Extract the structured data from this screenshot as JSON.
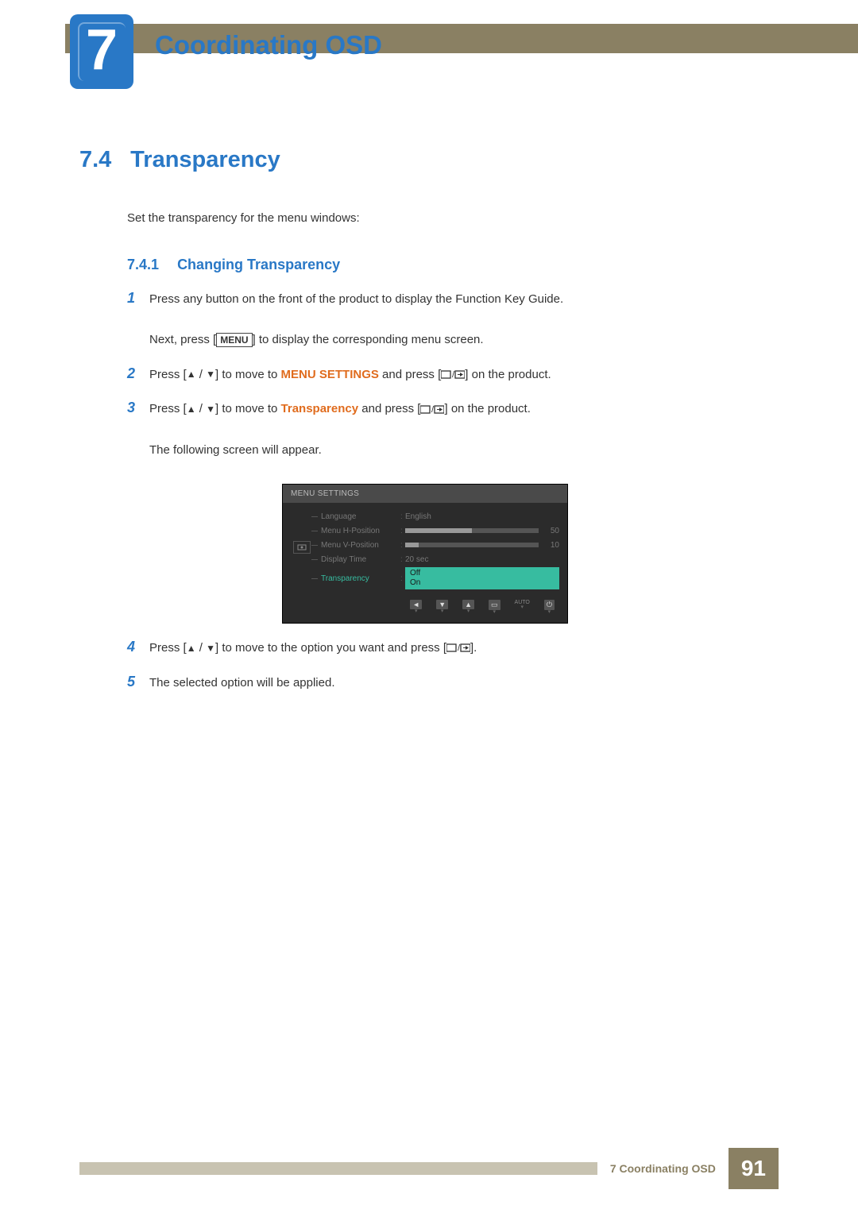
{
  "chapter": {
    "number": "7",
    "title": "Coordinating OSD"
  },
  "section": {
    "number": "7.4",
    "title": "Transparency",
    "intro": "Set the transparency for the menu windows:"
  },
  "subsection": {
    "number": "7.4.1",
    "title": "Changing Transparency"
  },
  "steps": {
    "s1": {
      "num": "1",
      "text1": "Press any button on the front of the product to display the Function Key Guide.",
      "text2a": "Next, press [",
      "menu": "MENU",
      "text2b": "] to display the corresponding menu screen."
    },
    "s2": {
      "num": "2",
      "text1": "Press [",
      "text2": "] to move to ",
      "bold": "MENU SETTINGS",
      "text3": " and press [",
      "text4": "] on the product."
    },
    "s3": {
      "num": "3",
      "text1": "Press [",
      "text2": "] to move to ",
      "bold": "Transparency",
      "text3": " and press [",
      "text4": "] on the product.",
      "follow": "The following screen will appear."
    },
    "s4": {
      "num": "4",
      "text1": "Press [",
      "text2": "] to move to the option you want and press [",
      "text3": "]."
    },
    "s5": {
      "num": "5",
      "text": "The selected option will be applied."
    }
  },
  "osd": {
    "header": "MENU SETTINGS",
    "rows": {
      "language": {
        "label": "Language",
        "value": "English"
      },
      "hpos": {
        "label": "Menu H-Position",
        "value": "50",
        "fillPct": 50
      },
      "vpos": {
        "label": "Menu V-Position",
        "value": "10",
        "fillPct": 10
      },
      "dtime": {
        "label": "Display Time",
        "value": "20 sec"
      },
      "transp": {
        "label": "Transparency",
        "opt1": "Off",
        "opt2": "On"
      }
    },
    "nav": {
      "auto": "AUTO"
    }
  },
  "footer": {
    "chapter": "7 Coordinating OSD",
    "page": "91"
  }
}
